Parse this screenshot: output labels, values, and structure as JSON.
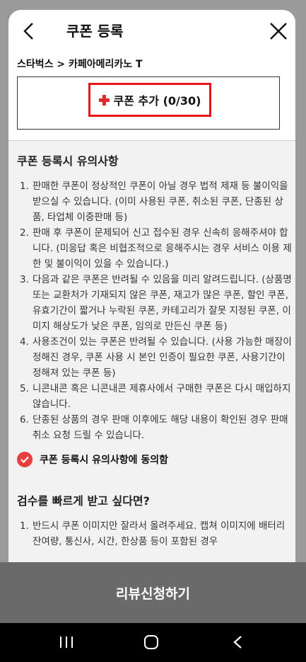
{
  "header": {
    "title": "쿠폰 등록"
  },
  "breadcrumb": "스타벅스 > 카페아메리카노 T",
  "add_coupon": {
    "label": "쿠폰 추가 (0/30)"
  },
  "notice": {
    "title": "쿠폰 등록시 유의사항",
    "items": [
      {
        "num": "1.",
        "text": "판매한 쿠폰이 정상적인 쿠폰이 아닐 경우 법적 제재 등 불이익을 받으실 수 있습니다. (이미 사용된 쿠폰, 취소된 쿠폰, 단종된 상품, 타업체 이중판매 등)"
      },
      {
        "num": "2.",
        "text": "판매 후 쿠폰이 문제되어 신고 접수된 경우 신속히 응해주셔야 합니다. (미응답 혹은 비협조적으로 응해주시는 경우 서비스 이용 제한 및 불이익이 있을 수 있습니다.)"
      },
      {
        "num": "3.",
        "text": "다음과 같은 쿠폰은 반려될 수 있음을 미리 알려드립니다. (상품명 또는 교환처가 기재되지 않은 쿠폰, 재고가 많은 쿠폰, 할인 쿠폰, 유효기간이 짧거나 누락된 쿠폰, 카테고리가 잘못 지정된 쿠폰, 이미지 해상도가 낮은 쿠폰, 임의로 만든신 쿠폰 등)"
      },
      {
        "num": "4.",
        "text": "사용조건이 있는 쿠폰은 반려될 수 있습니다. (사용 가능한 매장이 정해진 경우, 쿠폰 사용 시 본인 인증이 필요한 쿠폰, 사용기간이 정해져 있는 쿠폰 등)"
      },
      {
        "num": "5.",
        "text": "니콘내콘 혹은 니콘내콘 제휴사에서 구매한 쿠폰은 다시 매입하지 않습니다."
      },
      {
        "num": "6.",
        "text": "단종된 상품의 경우 판매 이후에도 해당 내용이 확인된 경우 판매 취소 요청 드릴 수 있습니다."
      }
    ],
    "agree_label": "쿠폰 등록시 유의사항에 동의함"
  },
  "review_tips": {
    "title": "검수를 빠르게 받고 싶다면?",
    "items": [
      {
        "num": "1.",
        "text": "반드시 쿠폰 이미지만 잘라서 올려주세요. 캡쳐 이미지에 배터리 잔여량, 통신사, 시간, 한상품 등이 포함된 경우"
      }
    ]
  },
  "submit_button": "리뷰신청하기",
  "icons": {
    "back": "chevron-left-icon",
    "close": "close-icon",
    "plus": "plus-icon",
    "check": "check-circle-icon",
    "nav_recent": "recent-apps-icon",
    "nav_home": "home-icon",
    "nav_back": "nav-back-icon"
  },
  "colors": {
    "accent_red": "#e8131b",
    "check_red": "#e84040",
    "submit_bg": "#6a6a6a"
  }
}
